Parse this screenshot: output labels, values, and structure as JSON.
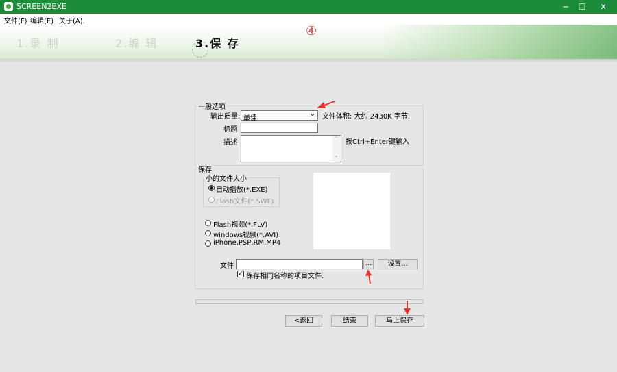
{
  "window": {
    "title": "SCREEN2EXE",
    "minimize": "─",
    "maximize": "☐",
    "close": "✕"
  },
  "menu": [
    "文件(F)",
    "编辑(E)",
    "关于(A)."
  ],
  "steps": [
    "1.录  制",
    "2.编  辑",
    "3.保  存"
  ],
  "annotation": "④",
  "general": {
    "title": "一般选项",
    "quality_label": "输出质量:",
    "quality_value": "最佳",
    "file_size": "文件体积: 大约 2430K 字节.",
    "title_label": "标题",
    "title_value": "",
    "desc_label": "描述",
    "desc_value": "",
    "desc_hint": "按Ctrl+Enter键输入"
  },
  "save": {
    "title": "保存",
    "small_group_title": "小的文件大小",
    "options_small": [
      {
        "label": "自动播放(*.EXE)",
        "selected": true,
        "enabled": true
      },
      {
        "label": "Flash文件(*.SWF)",
        "selected": false,
        "enabled": false
      }
    ],
    "options_other": [
      {
        "label": "Flash视频(*.FLV)",
        "selected": false
      },
      {
        "label": "windows视频(*.AVI)",
        "selected": false
      },
      {
        "label": "iPhone,PSP,RM,MP4",
        "selected": false
      }
    ],
    "file_label": "文件",
    "file_value": "",
    "browse_label": "...",
    "settings_label": "设置...",
    "checkbox_label": "保存相同名称的项目文件.",
    "checkbox_checked": true
  },
  "buttons": {
    "back": "<返回",
    "finish": "结束",
    "save_now": "马上保存"
  },
  "colors": {
    "titlebar": "#1c8b3a",
    "arrow": "#e33333"
  }
}
